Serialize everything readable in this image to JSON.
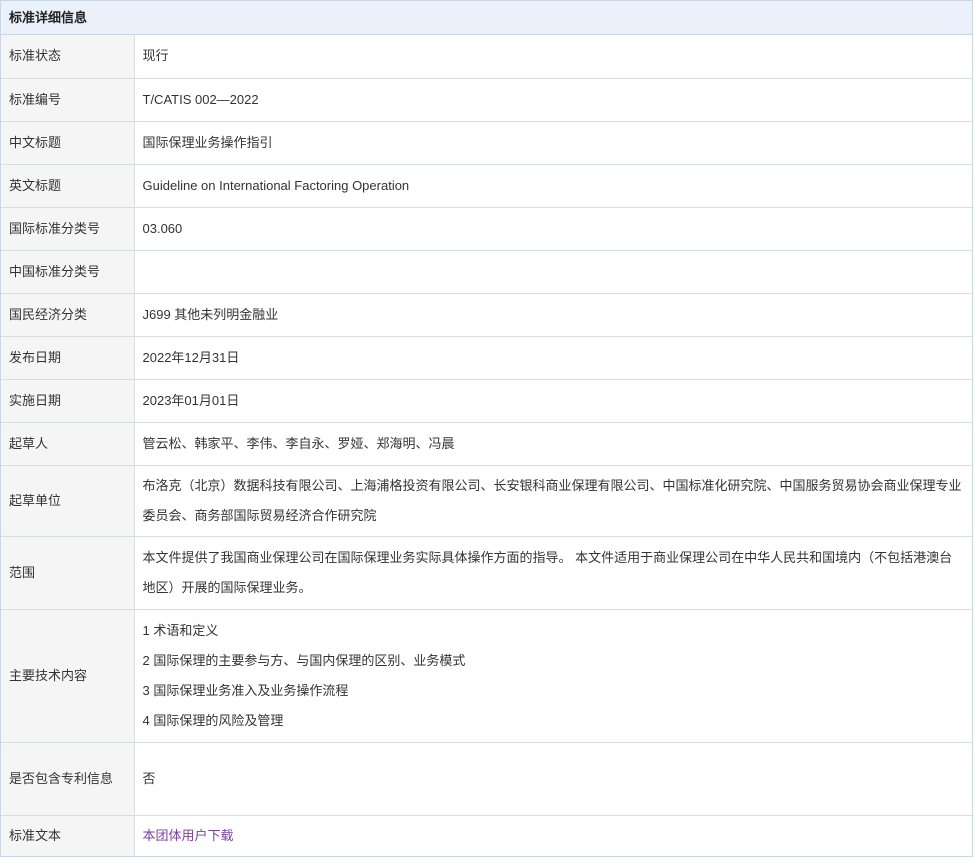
{
  "header": {
    "title": "标准详细信息"
  },
  "rows": {
    "status": {
      "label": "标准状态",
      "value": "现行"
    },
    "number": {
      "label": "标准编号",
      "value": "T/CATIS 002—2022"
    },
    "cn_title": {
      "label": "中文标题",
      "value": "国际保理业务操作指引"
    },
    "en_title": {
      "label": "英文标题",
      "value": "Guideline on International Factoring Operation"
    },
    "ics": {
      "label": "国际标准分类号",
      "value": "03.060"
    },
    "ccs": {
      "label": "中国标准分类号",
      "value": ""
    },
    "economy": {
      "label": "国民经济分类",
      "value": "J699 其他未列明金融业"
    },
    "publish_date": {
      "label": "发布日期",
      "value": "2022年12月31日"
    },
    "impl_date": {
      "label": "实施日期",
      "value": "2023年01月01日"
    },
    "drafters": {
      "label": "起草人",
      "value": "管云松、韩家平、李伟、李自永、罗娅、郑海明、冯晨"
    },
    "drafting_units": {
      "label": "起草单位",
      "value": "布洛克（北京）数据科技有限公司、上海浦格投资有限公司、长安银科商业保理有限公司、中国标准化研究院、中国服务贸易协会商业保理专业委员会、商务部国际贸易经济合作研究院"
    },
    "scope": {
      "label": "范围",
      "value": "本文件提供了我国商业保理公司在国际保理业务实际具体操作方面的指导。 本文件适用于商业保理公司在中华人民共和国境内（不包括港澳台地区）开展的国际保理业务。"
    },
    "tech_content": {
      "label": "主要技术内容",
      "items": [
        "1 术语和定义",
        "2 国际保理的主要参与方、与国内保理的区别、业务模式",
        "3 国际保理业务准入及业务操作流程",
        "4 国际保理的风险及管理"
      ]
    },
    "patent": {
      "label": "是否包含专利信息",
      "value": "否"
    },
    "standard_text": {
      "label": "标准文本",
      "link": "本团体用户下载"
    }
  },
  "colors": {
    "header_bg": "#eaf1fa",
    "label_bg": "#f5f5f5",
    "link": "#7a3fa0",
    "border": "#d8dde4"
  }
}
